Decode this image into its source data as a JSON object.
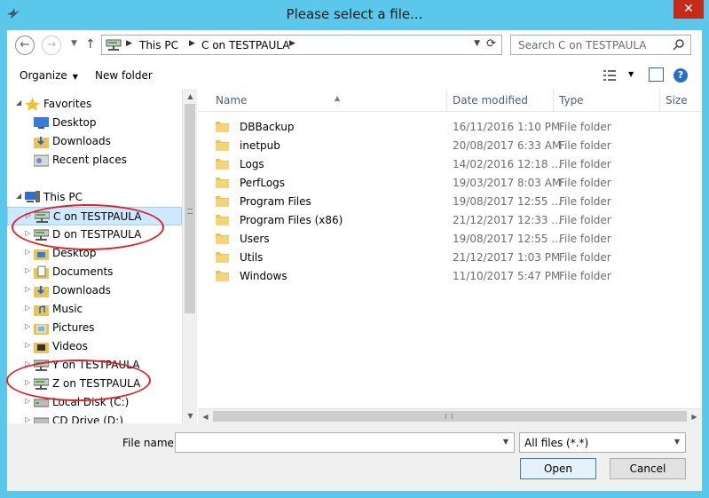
{
  "window": {
    "title": "Please select a file...",
    "close_glyph": "✕",
    "accent_color": "#5bc7ea"
  },
  "nav": {
    "back_glyph": "←",
    "forward_glyph": "→",
    "up_glyph": "↑",
    "breadcrumbs": [
      "This PC",
      "C on TESTPAULA"
    ],
    "search_placeholder": "Search C on TESTPAULA"
  },
  "toolbar": {
    "organize_label": "Organize",
    "new_folder_label": "New folder",
    "help_glyph": "?"
  },
  "tree": {
    "favorites": "Favorites",
    "desktop_fav": "Desktop",
    "downloads_fav": "Downloads",
    "recent": "Recent places",
    "this_pc": "This PC",
    "c_drive": "C on TESTPAULA",
    "d_drive": "D on TESTPAULA",
    "desktop": "Desktop",
    "documents": "Documents",
    "downloads": "Downloads",
    "music": "Music",
    "pictures": "Pictures",
    "videos": "Videos",
    "y_drive": "Y on TESTPAULA",
    "z_drive": "Z on TESTPAULA",
    "local_disk": "Local Disk (C:)",
    "cd_drive": "CD Drive (D:)"
  },
  "columns": {
    "name": "Name",
    "date": "Date modified",
    "type": "Type",
    "size": "Size"
  },
  "files": [
    {
      "name": "DBBackup",
      "date": "16/11/2016 1:10 PM",
      "type": "File folder"
    },
    {
      "name": "inetpub",
      "date": "20/08/2017 6:33 AM",
      "type": "File folder"
    },
    {
      "name": "Logs",
      "date": "14/02/2016 12:18 ...",
      "type": "File folder"
    },
    {
      "name": "PerfLogs",
      "date": "19/03/2017 8:03 AM",
      "type": "File folder"
    },
    {
      "name": "Program Files",
      "date": "19/08/2017 12:55 ...",
      "type": "File folder"
    },
    {
      "name": "Program Files (x86)",
      "date": "21/12/2017 12:33 ...",
      "type": "File folder"
    },
    {
      "name": "Users",
      "date": "19/08/2017 12:55 ...",
      "type": "File folder"
    },
    {
      "name": "Utils",
      "date": "21/12/2017 1:03 PM",
      "type": "File folder"
    },
    {
      "name": "Windows",
      "date": "11/10/2017 5:47 PM",
      "type": "File folder"
    }
  ],
  "bottom": {
    "file_name_label": "File name:",
    "file_name_value": "",
    "filter_value": "All files (*.*)",
    "open_label": "Open",
    "cancel_label": "Cancel"
  }
}
